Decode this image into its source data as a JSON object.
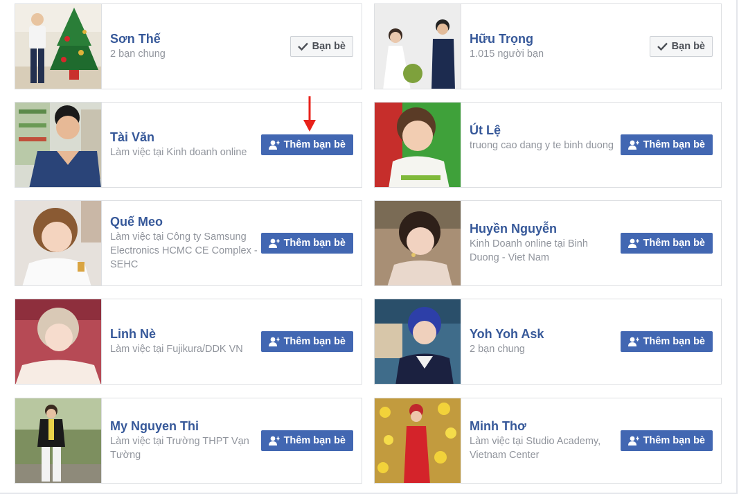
{
  "colors": {
    "link_blue": "#365899",
    "button_blue": "#4267b2",
    "secondary_text": "#90949c",
    "annotation_arrow": "#e8211a"
  },
  "icons": {
    "add_friend": "person-plus-icon",
    "friends": "checkmark-icon",
    "annotation": "red-down-arrow-icon"
  },
  "cards": [
    {
      "name": "Sơn Thế",
      "sub": "2 bạn chung",
      "button": "Bạn bè",
      "state": "friends"
    },
    {
      "name": "Hữu Trọng",
      "sub": "1.015 người bạn",
      "button": "Bạn bè",
      "state": "friends"
    },
    {
      "name": "Tài Văn",
      "sub": "Làm việc tại Kinh doanh online",
      "button": "Thêm bạn bè",
      "state": "add"
    },
    {
      "name": "Út Lệ",
      "sub": "truong cao dang y te binh duong",
      "button": "Thêm bạn bè",
      "state": "add"
    },
    {
      "name": "Quế Meo",
      "sub": "Làm việc tại Công ty Samsung Electronics HCMC CE Complex - SEHC",
      "button": "Thêm bạn bè",
      "state": "add"
    },
    {
      "name": "Huyền Nguyễn",
      "sub": "Kinh Doanh online tại Binh Duong - Viet Nam",
      "button": "Thêm bạn bè",
      "state": "add"
    },
    {
      "name": "Linh Nè",
      "sub": "Làm việc tại Fujikura/DDK VN",
      "button": "Thêm bạn bè",
      "state": "add"
    },
    {
      "name": "Yoh Yoh Ask",
      "sub": "2 bạn chung",
      "button": "Thêm bạn bè",
      "state": "add"
    },
    {
      "name": "My Nguyen Thi",
      "sub": "Làm việc tại Trường THPT Vạn Tường",
      "button": "Thêm bạn bè",
      "state": "add"
    },
    {
      "name": "Minh Thơ",
      "sub": "Làm việc tại Studio Academy, Vietnam Center",
      "button": "Thêm bạn bè",
      "state": "add"
    }
  ]
}
